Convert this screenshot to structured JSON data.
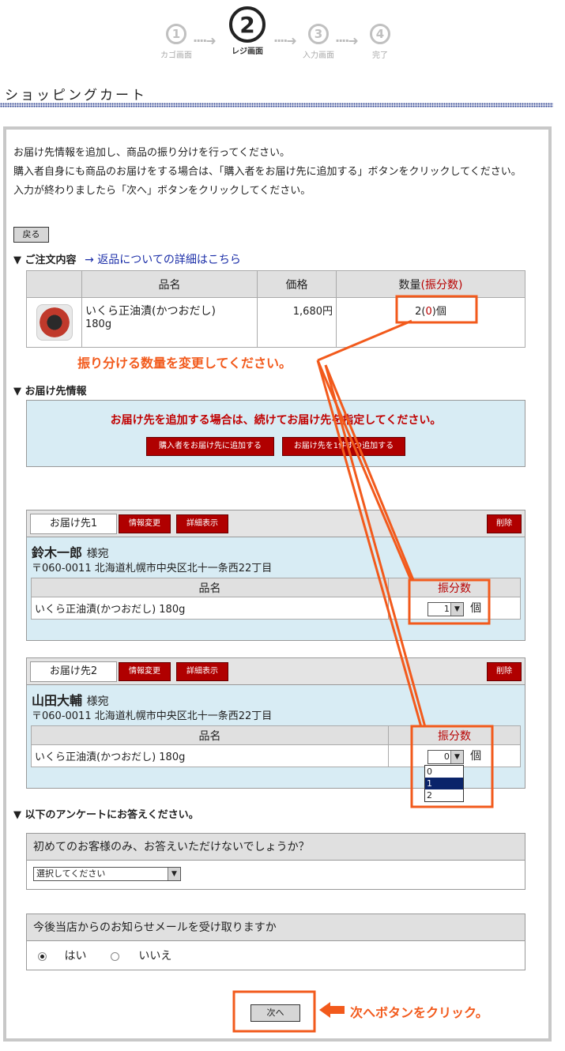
{
  "steps": [
    {
      "num": "1",
      "label": "カゴ画面"
    },
    {
      "num": "2",
      "label": "レジ画面"
    },
    {
      "num": "3",
      "label": "入力画面"
    },
    {
      "num": "4",
      "label": "完了"
    }
  ],
  "step_arrow": "····➜",
  "page_title": "ショッピングカート",
  "intro": {
    "line1": "お届け先情報を追加し、商品の振り分けを行ってください。",
    "line2": "購入者自身にも商品のお届けをする場合は、「購入者をお届け先に追加する」ボタンをクリックしてください。",
    "line3": "入力が終わりましたら「次へ」ボタンをクリックしてください。"
  },
  "back_button": "戻る",
  "order_section": {
    "heading": "▼ ご注文内容",
    "link": "→ 返品についての詳細はこちら",
    "headers": {
      "name": "品名",
      "price": "価格",
      "qty": "数量",
      "alloc_label": "振分数"
    },
    "item": {
      "name": "いくら正油漬(かつおだし)",
      "size": "180g",
      "price": "1,680円",
      "qty": "2",
      "alloc": "0",
      "unit": "個"
    }
  },
  "annotation_qty": "振り分ける数量を変更してください。",
  "delivery_section": {
    "heading": "▼ お届け先情報",
    "message": "お届け先を追加する場合は、続けてお届け先を指定してください。",
    "add_buyer_button": "購入者をお届け先に追加する",
    "add_one_button": "お届け先を1件ずつ追加する"
  },
  "destinations": [
    {
      "tab": "お届け先1",
      "edit_button": "情報変更",
      "detail_button": "詳細表示",
      "delete_button": "削除",
      "name": "鈴木一郎",
      "honorific": "様宛",
      "address": "〒060-0011 北海道札幌市中央区北十一条西22丁目",
      "col_name": "品名",
      "col_alloc": "振分数",
      "item": "いくら正油漬(かつおだし) 180g",
      "alloc_value": "1",
      "unit": "個"
    },
    {
      "tab": "お届け先2",
      "edit_button": "情報変更",
      "detail_button": "詳細表示",
      "delete_button": "削除",
      "name": "山田大輔",
      "honorific": "様宛",
      "address": "〒060-0011 北海道札幌市中央区北十一条西22丁目",
      "col_name": "品名",
      "col_alloc": "振分数",
      "item": "いくら正油漬(かつおだし) 180g",
      "alloc_value": "0",
      "unit": "個",
      "dropdown_options": [
        "0",
        "1",
        "2"
      ],
      "dropdown_highlight": "1"
    }
  ],
  "survey": {
    "heading": "▼ 以下のアンケートにお答えください。",
    "q1": "初めてのお客様のみ、お答えいただけないでしょうか？",
    "q1_select": "選択してください",
    "q2": "今後当店からのお知らせメールを受け取りますか",
    "q2_yes": "はい",
    "q2_no": "いいえ"
  },
  "next_button": "次へ",
  "annotation_next": "次へボタンをクリック。",
  "colors": {
    "accent": "#f25a1c",
    "red": "#b00000",
    "panel": "#d8ecf4"
  }
}
